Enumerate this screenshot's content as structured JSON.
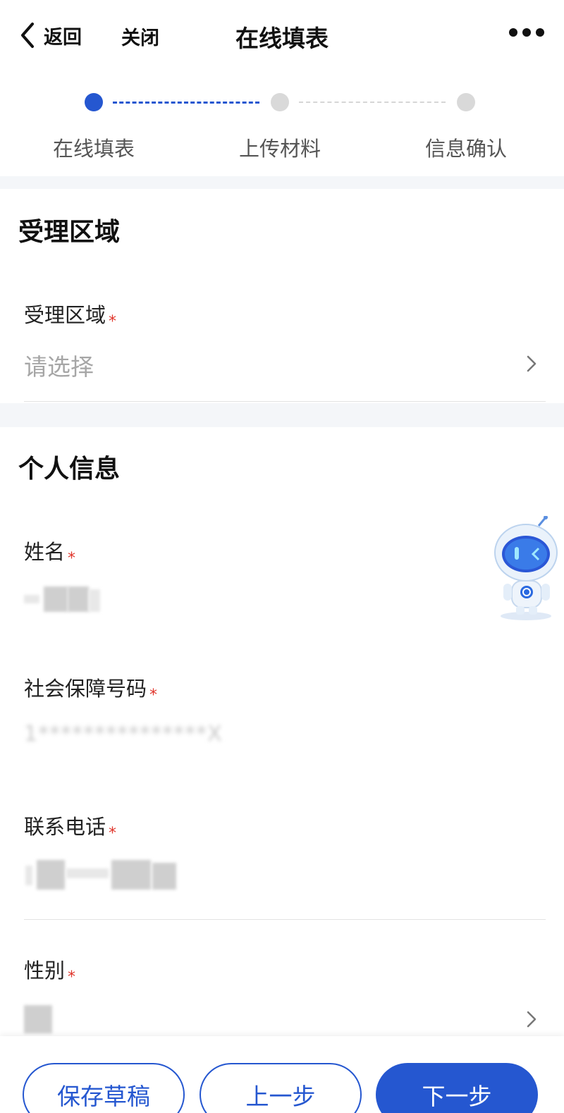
{
  "nav": {
    "back_label": "返回",
    "close_label": "关闭",
    "title": "在线填表"
  },
  "steps": [
    {
      "label": "在线填表",
      "state": "active"
    },
    {
      "label": "上传材料",
      "state": "inactive"
    },
    {
      "label": "信息确认",
      "state": "inactive"
    }
  ],
  "section_area": {
    "title": "受理区域",
    "field_label": "受理区域",
    "required_mark": "*",
    "placeholder": "请选择"
  },
  "section_personal": {
    "title": "个人信息",
    "fields": {
      "name": {
        "label": "姓名",
        "required_mark": "*"
      },
      "social_security": {
        "label": "社会保障号码",
        "required_mark": "*",
        "masked_value": "1***************X"
      },
      "phone": {
        "label": "联系电话",
        "required_mark": "*"
      },
      "gender": {
        "label": "性别",
        "required_mark": "*"
      }
    }
  },
  "buttons": {
    "save_draft": "保存草稿",
    "prev": "上一步",
    "next": "下一步"
  },
  "colors": {
    "accent": "#2557d0",
    "required": "#e0352b",
    "placeholder": "#a6a6a6"
  }
}
